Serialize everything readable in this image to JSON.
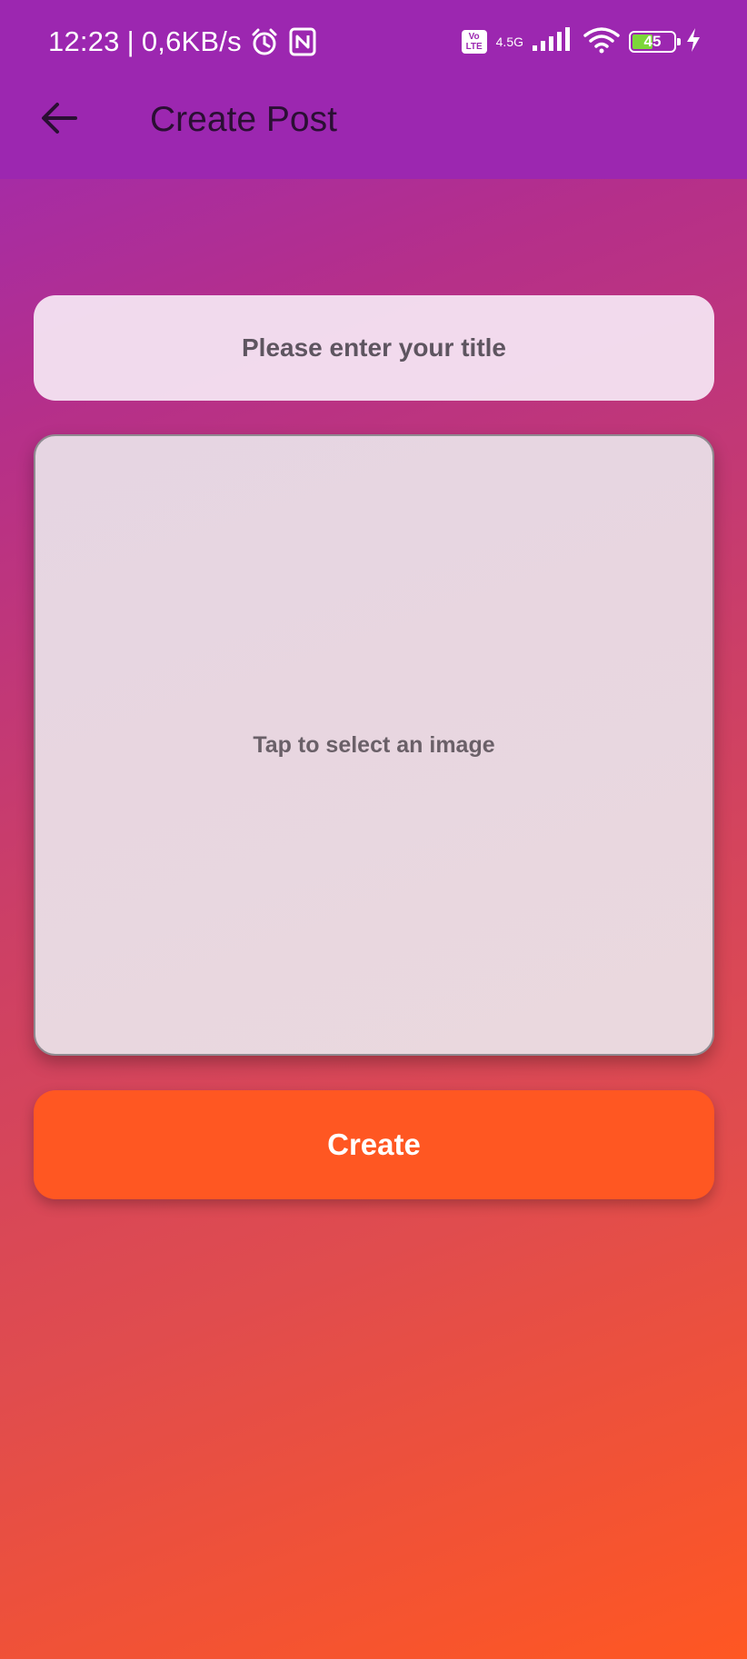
{
  "status_bar": {
    "time": "12:23",
    "separator": "|",
    "speed": "0,6KB/s",
    "volte_top": "Vo",
    "volte_bottom": "LTE",
    "network_gen": "4.5G",
    "battery_level": "45",
    "battery_fraction": 0.45,
    "icons": [
      "alarm-icon",
      "nfc-icon",
      "signal-icon",
      "wifi-icon",
      "battery-icon",
      "charging-icon"
    ]
  },
  "appbar": {
    "title": "Create Post",
    "back_icon": "arrow-left-icon",
    "background": "#9c27b0"
  },
  "form": {
    "title_placeholder": "Please enter your title",
    "title_value": "",
    "image_picker_label": "Tap to select an image",
    "create_label": "Create"
  },
  "colors": {
    "accent": "#ff5722",
    "gradient_start": "#9b2ab8",
    "gradient_end": "#ff5722"
  }
}
